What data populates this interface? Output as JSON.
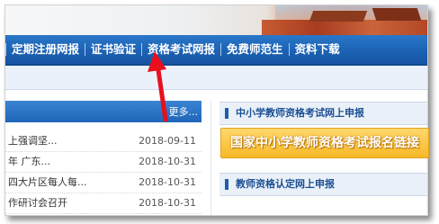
{
  "nav": {
    "items": [
      {
        "label": "定期注册网报"
      },
      {
        "label": "证书验证"
      },
      {
        "label": "资格考试网报"
      },
      {
        "label": "免费师范生"
      },
      {
        "label": "资料下载"
      }
    ]
  },
  "news": {
    "more_label": "更多...",
    "items": [
      {
        "title": "上强调坚...",
        "date": "2018-09-11"
      },
      {
        "title": "年 广东...",
        "date": "2018-10-31"
      },
      {
        "title": "四大片区每人每...",
        "date": "2018-10-31"
      },
      {
        "title": "作研讨会召开",
        "date": "2018-10-31"
      }
    ]
  },
  "right": {
    "section1_title": "中小学教师资格考试网上申报",
    "banner_text": "国家中小学教师资格考试报名链接",
    "section2_title": "教师资格认定网上申报"
  },
  "colors": {
    "nav_blue": "#1c62b4",
    "arrow_red": "#e8101c",
    "banner_gold": "#f7b928"
  },
  "annotation": {
    "arrow_icon": "red-arrow-icon",
    "points_to": "证书验证"
  }
}
